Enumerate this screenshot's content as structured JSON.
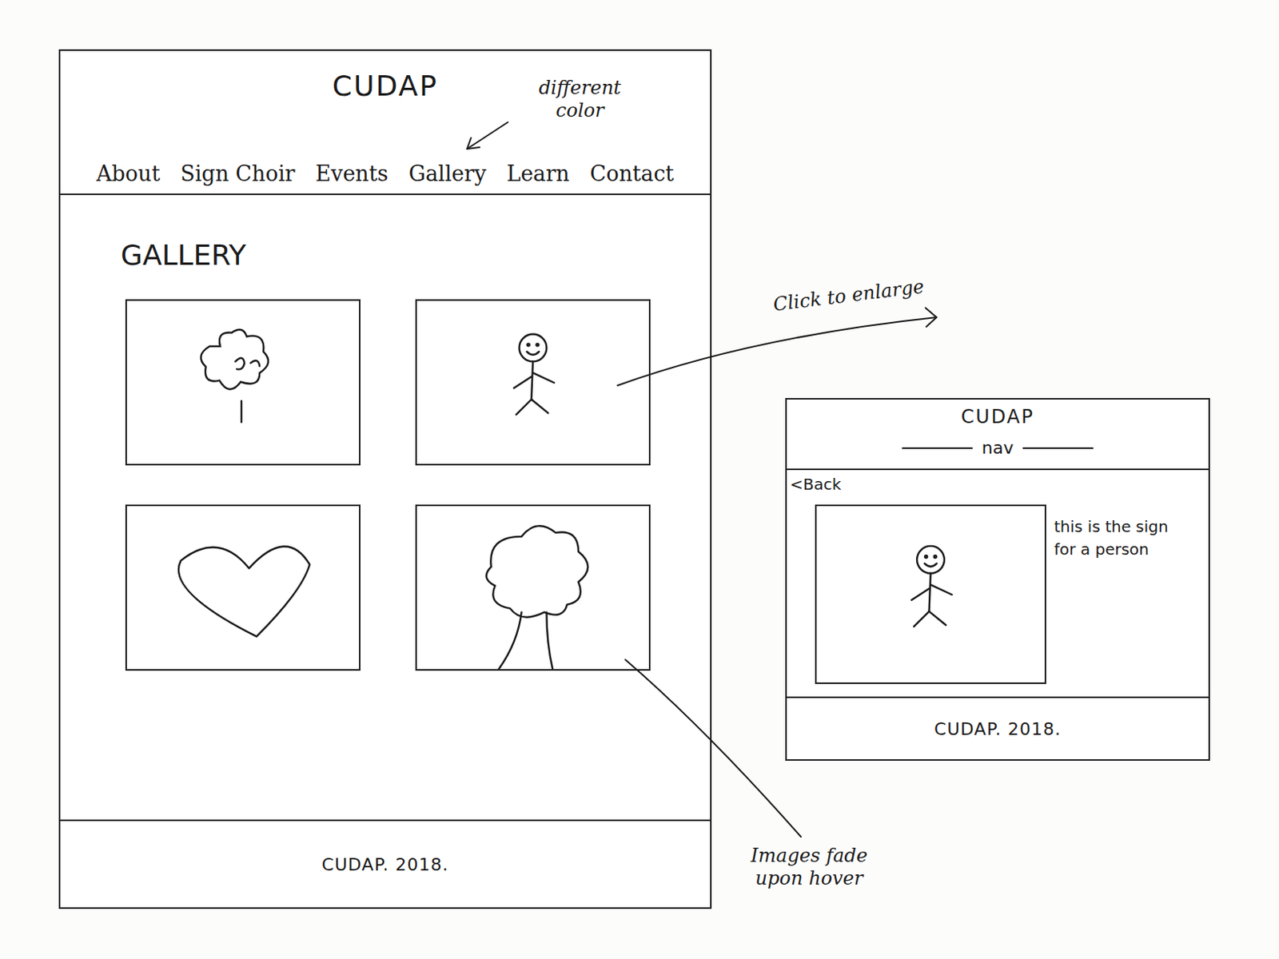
{
  "main_page": {
    "logo": "CUDAP",
    "nav": [
      "About",
      "Sign Choir",
      "Events",
      "Gallery",
      "Learn",
      "Contact"
    ],
    "heading": "GALLERY",
    "images": [
      {
        "kind": "small-tree"
      },
      {
        "kind": "person"
      },
      {
        "kind": "heart"
      },
      {
        "kind": "tree"
      }
    ],
    "footer": "CUDAP. 2018."
  },
  "detail_page": {
    "logo": "CUDAP",
    "nav": "nav",
    "back": "<Back",
    "image": {
      "kind": "person"
    },
    "caption": "this is the sign for a person",
    "footer": "CUDAP. 2018."
  },
  "annotations": {
    "nav_color": "different color",
    "click": "Click to enlarge",
    "hover": "Images fade upon hover"
  }
}
